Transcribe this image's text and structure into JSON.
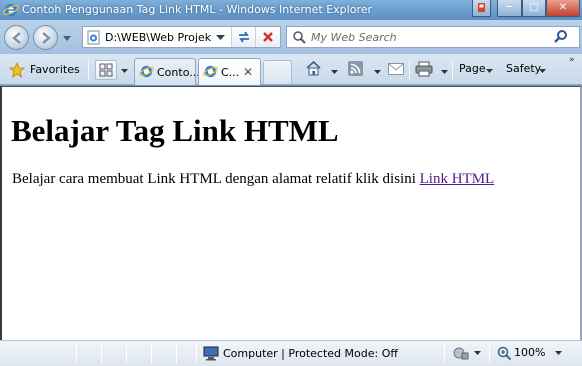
{
  "window": {
    "title": "Contoh Penggunaan Tag Link HTML - Windows Internet Explorer"
  },
  "nav": {
    "address": "D:\\WEB\\Web Projek",
    "search_placeholder": "My Web Search"
  },
  "command_bar": {
    "favorites_label": "Favorites",
    "tabs": [
      {
        "label": "Conto..."
      },
      {
        "label": "C..."
      }
    ],
    "page_label": "Page",
    "safety_label": "Safety"
  },
  "page": {
    "heading": "Belajar Tag Link HTML",
    "paragraph": "Belajar cara membuat Link HTML dengan alamat relatif klik disini",
    "link_text": "Link HTML",
    "link_color": "#551a8b"
  },
  "status_bar": {
    "zone_text": "Computer | Protected Mode: Off",
    "zoom": "100%"
  },
  "icons": [
    "ie-icon",
    "back-icon",
    "forward-icon",
    "refresh-icon",
    "stop-icon",
    "search-icon",
    "star-icon",
    "quick-tabs-icon",
    "home-icon",
    "rss-icon",
    "mail-icon",
    "print-icon",
    "computer-icon",
    "zoom-icon"
  ],
  "colors": {
    "titlebar": "#6e9bc6",
    "content_bg": "#ffffff"
  }
}
